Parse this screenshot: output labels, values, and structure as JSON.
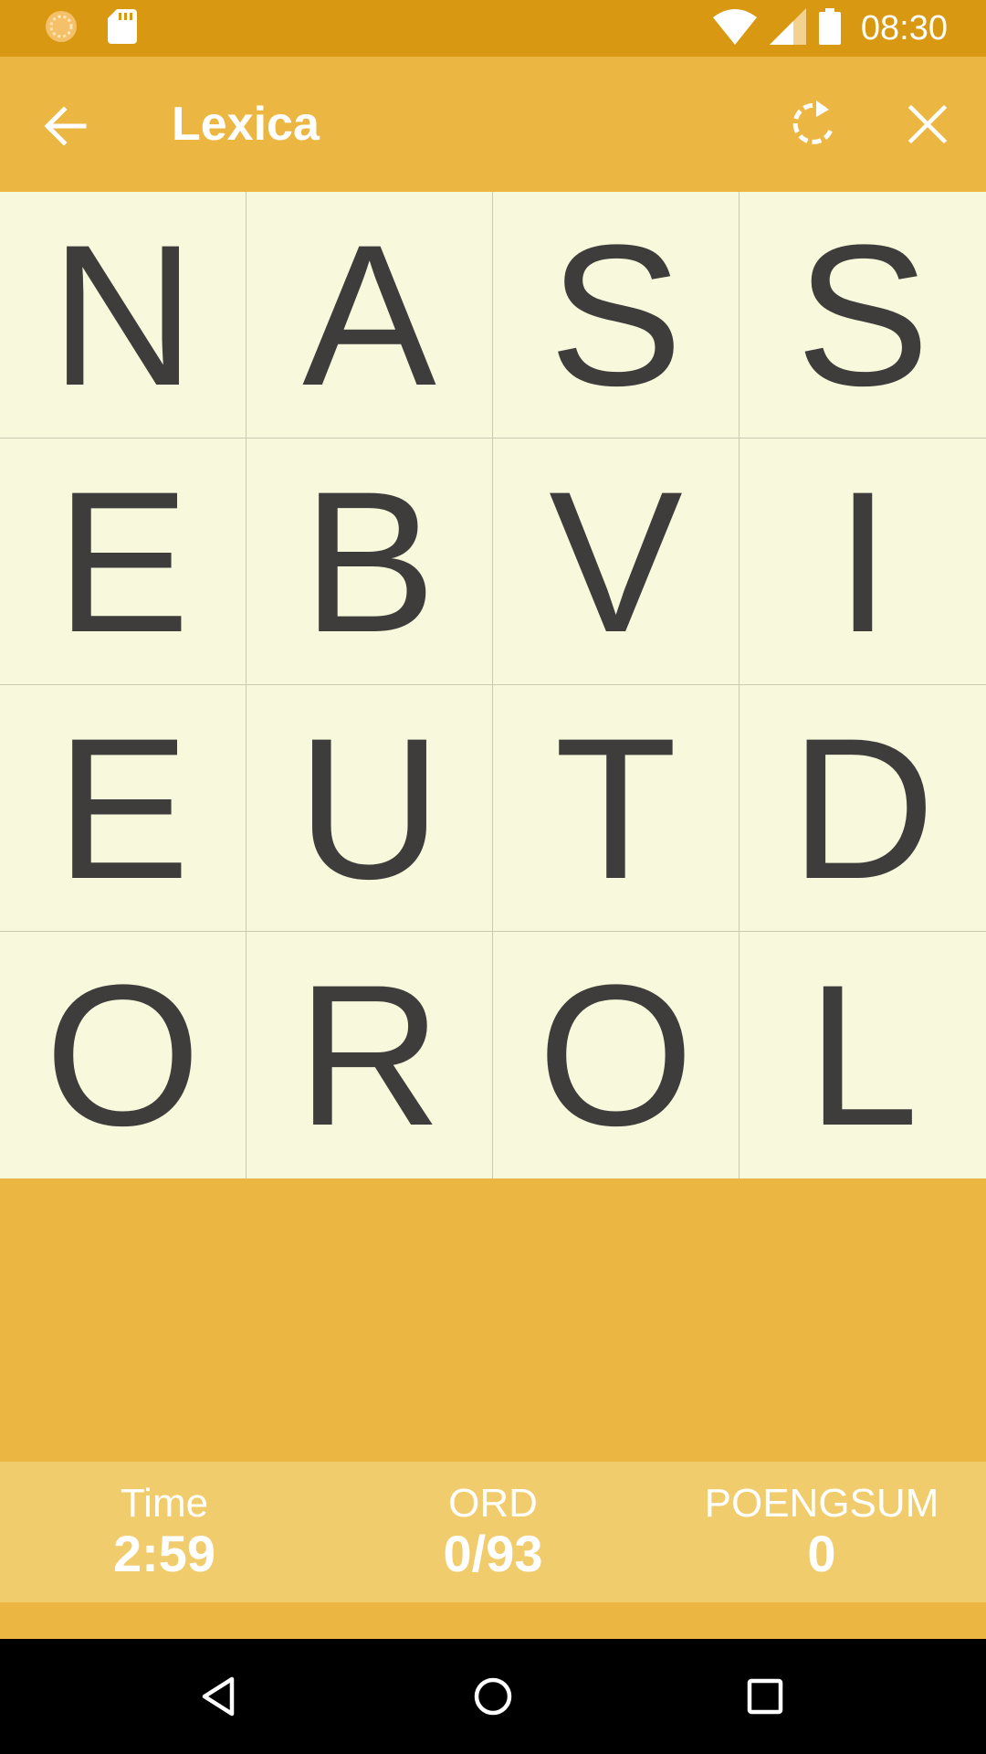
{
  "status_bar": {
    "time": "08:30",
    "icons": [
      "sync-icon",
      "sd-card-icon",
      "wifi-icon",
      "signal-icon",
      "battery-icon"
    ]
  },
  "app_bar": {
    "title": "Lexica",
    "icons": [
      "back-arrow-icon",
      "refresh-icon",
      "close-icon"
    ]
  },
  "board": {
    "rows": [
      [
        "N",
        "A",
        "S",
        "S"
      ],
      [
        "E",
        "B",
        "V",
        "I"
      ],
      [
        "E",
        "U",
        "T",
        "D"
      ],
      [
        "O",
        "R",
        "O",
        "L"
      ]
    ]
  },
  "stats": {
    "time": {
      "label": "Time",
      "value": "2:59"
    },
    "words": {
      "label": "ORD",
      "value": "0/93"
    },
    "score": {
      "label": "POENGSUM",
      "value": "0"
    }
  },
  "colors": {
    "status_bar": "#d99812",
    "app_bar": "#ecb642",
    "board": "#f8f8dc",
    "letter": "#3f3d3b",
    "stats_bar": "#f0cc6d"
  },
  "nav_bar": {
    "icons": [
      "back-triangle-icon",
      "home-circle-icon",
      "recents-square-icon"
    ]
  }
}
